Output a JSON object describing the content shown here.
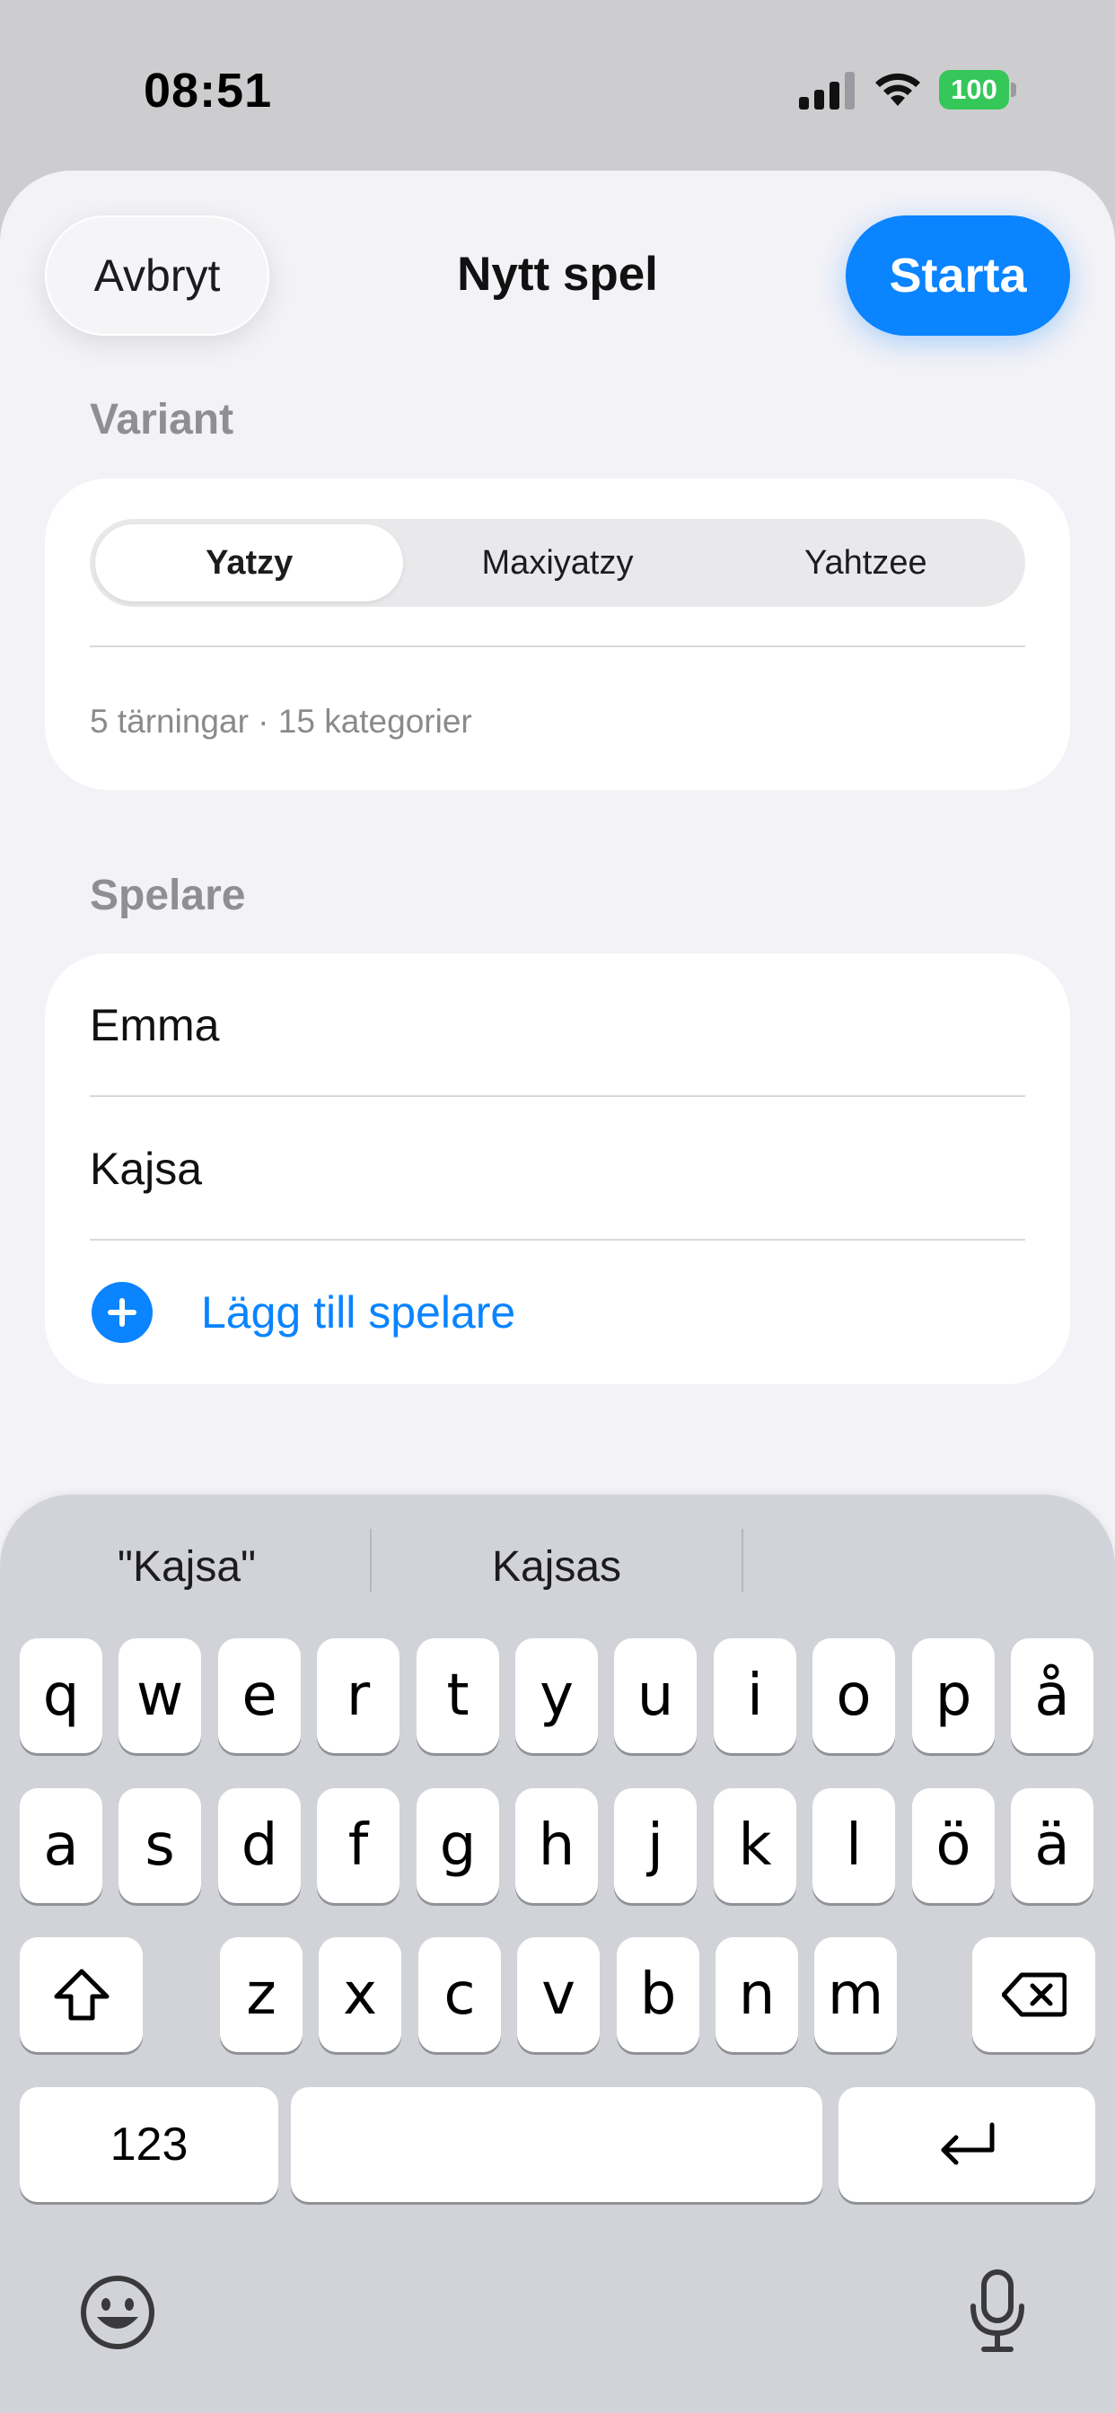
{
  "status_bar": {
    "time": "08:51",
    "battery": "100",
    "icons": [
      "cellular-signal-icon",
      "wifi-icon",
      "battery-icon"
    ],
    "battery_color": "#35c759"
  },
  "header": {
    "cancel_label": "Avbryt",
    "title": "Nytt spel",
    "start_label": "Starta",
    "accent_color": "#0a84ff"
  },
  "variant": {
    "section_label": "Variant",
    "options": [
      "Yatzy",
      "Maxiyatzy",
      "Yahtzee"
    ],
    "selected": "Yatzy",
    "info": "5 tärningar · 15 kategorier"
  },
  "players": {
    "section_label": "Spelare",
    "list": [
      "Emma",
      "Kajsa"
    ],
    "add_label": "Lägg till spelare"
  },
  "keyboard": {
    "suggestions": [
      "\"Kajsa\"",
      "Kajsas",
      ""
    ],
    "rows": [
      [
        "q",
        "w",
        "e",
        "r",
        "t",
        "y",
        "u",
        "i",
        "o",
        "p",
        "å"
      ],
      [
        "a",
        "s",
        "d",
        "f",
        "g",
        "h",
        "j",
        "k",
        "l",
        "ö",
        "ä"
      ],
      [
        "z",
        "x",
        "c",
        "v",
        "b",
        "n",
        "m"
      ]
    ],
    "numbers_label": "123",
    "space_label": "",
    "icons": [
      "shift-icon",
      "delete-icon",
      "return-icon",
      "emoji-icon",
      "microphone-icon"
    ]
  }
}
